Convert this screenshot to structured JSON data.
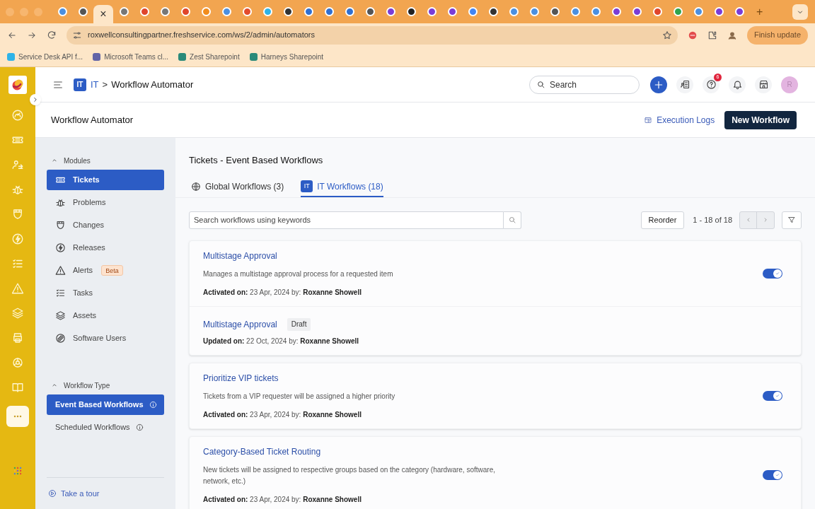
{
  "browser": {
    "tabs": [
      {
        "selected": false,
        "color": "#4b8fe0"
      },
      {
        "selected": false,
        "color": "#555555"
      },
      {
        "selected": true,
        "close": "×"
      },
      {
        "selected": false,
        "color": "#777777"
      },
      {
        "selected": false,
        "color": "#e0452b"
      },
      {
        "selected": false,
        "color": "#777777"
      },
      {
        "selected": false,
        "color": "#e0452b"
      },
      {
        "selected": false,
        "color": "#f28c1b"
      },
      {
        "selected": false,
        "color": "#4b8fe0"
      },
      {
        "selected": false,
        "color": "#e34b2c"
      },
      {
        "selected": false,
        "color": "#2eb3e8"
      },
      {
        "selected": false,
        "color": "#333333"
      },
      {
        "selected": false,
        "color": "#2f6fd1"
      },
      {
        "selected": false,
        "color": "#2f6fd1"
      },
      {
        "selected": false,
        "color": "#2f6fd1"
      },
      {
        "selected": false,
        "color": "#555555"
      },
      {
        "selected": false,
        "color": "#7a3cd6"
      },
      {
        "selected": false,
        "color": "#222222"
      },
      {
        "selected": false,
        "color": "#7a3cd6"
      },
      {
        "selected": false,
        "color": "#7a3cd6"
      },
      {
        "selected": false,
        "color": "#4285f4"
      },
      {
        "selected": false,
        "color": "#333333"
      },
      {
        "selected": false,
        "color": "#4b8fe0"
      },
      {
        "selected": false,
        "color": "#4b8fe0"
      },
      {
        "selected": false,
        "color": "#555555"
      },
      {
        "selected": false,
        "color": "#4b8fe0"
      },
      {
        "selected": false,
        "color": "#4b8fe0"
      },
      {
        "selected": false,
        "color": "#7a3cd6"
      },
      {
        "selected": false,
        "color": "#7a3cd6"
      },
      {
        "selected": false,
        "color": "#e0452b"
      },
      {
        "selected": false,
        "color": "#2ea44f"
      },
      {
        "selected": false,
        "color": "#4b8fe0"
      },
      {
        "selected": false,
        "color": "#7a3cd6"
      },
      {
        "selected": false,
        "color": "#7a3cd6"
      }
    ],
    "new_tab": "+",
    "url": "roxwellconsultingpartner.freshservice.com/ws/2/admin/automators",
    "update_button": "Finish update",
    "bookmarks": [
      {
        "label": "Service Desk API f...",
        "color": "#2eb3e8"
      },
      {
        "label": "Microsoft Teams cl...",
        "color": "#6264a7"
      },
      {
        "label": "Zest Sharepoint",
        "color": "#2a8a7a"
      },
      {
        "label": "Harneys Sharepoint",
        "color": "#2a8a7a"
      }
    ]
  },
  "header": {
    "workspace_badge": "IT",
    "workspace": "IT",
    "separator": ">",
    "page": "Workflow Automator",
    "search_placeholder": "Search",
    "help_count": "6",
    "avatar": "R"
  },
  "subheader": {
    "title": "Workflow Automator",
    "logs_link": "Execution Logs",
    "new_button": "New Workflow"
  },
  "sidebar": {
    "sections": [
      {
        "title": "Modules",
        "expanded": true,
        "items": [
          {
            "label": "Tickets",
            "selected": true
          },
          {
            "label": "Problems",
            "selected": false
          },
          {
            "label": "Changes",
            "selected": false
          },
          {
            "label": "Releases",
            "selected": false
          },
          {
            "label": "Alerts",
            "badge": "Beta",
            "selected": false
          },
          {
            "label": "Tasks",
            "selected": false
          },
          {
            "label": "Assets",
            "selected": false
          },
          {
            "label": "Software Users",
            "selected": false
          }
        ]
      },
      {
        "title": "Workflow Type",
        "expanded": true,
        "items": [
          {
            "label": "Event Based Workflows",
            "info": true,
            "selected": true
          },
          {
            "label": "Scheduled Workflows",
            "info": true,
            "selected": false
          }
        ]
      }
    ],
    "tour": "Take a tour"
  },
  "main": {
    "title": "Tickets - Event Based Workflows",
    "tabs": [
      {
        "label": "Global Workflows (3)",
        "selected": false
      },
      {
        "label": "IT Workflows (18)",
        "badge": "IT",
        "selected": true
      }
    ],
    "search_placeholder": "Search workflows using keywords",
    "reorder": "Reorder",
    "pagination": "1 - 18 of 18",
    "cards": [
      {
        "items": [
          {
            "kind": "active",
            "title": "Multistage Approval",
            "description": "Manages a multistage approval process for a requested item",
            "meta": "**Activated on:** 23 Apr, 2024 by: **Roxanne Showell**",
            "on": true
          },
          {
            "kind": "draft",
            "title": "Multistage Approval",
            "badge": "Draft",
            "meta": "**Updated on:** 22 Oct, 2024 by: **Roxanne Showell**"
          }
        ]
      },
      {
        "items": [
          {
            "kind": "active",
            "title": "Prioritize VIP tickets",
            "description": "Tickets from a VIP requester will be assigned a higher priority",
            "meta": "**Activated on:** 23 Apr, 2024 by: **Roxanne Showell**",
            "on": true
          }
        ]
      },
      {
        "items": [
          {
            "kind": "active",
            "title": "Category-Based Ticket Routing",
            "description": "New tickets will be assigned to respective groups based on the category (hardware, software, network, etc.)",
            "meta": "**Activated on:** 23 Apr, 2024 by: **Roxanne Showell**",
            "on": true
          }
        ]
      }
    ]
  }
}
